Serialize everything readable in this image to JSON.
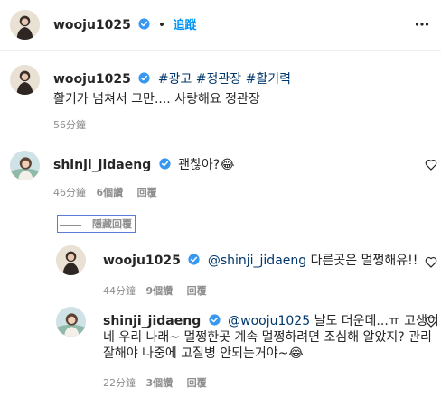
{
  "header": {
    "username": "wooju1025",
    "dot": "•",
    "follow_label": "追蹤",
    "more_icon": "more-horizontal-icon"
  },
  "caption": {
    "username": "wooju1025",
    "hashtags": [
      "#광고",
      "#정관장",
      "#활기력"
    ],
    "text": "활기가 넘쳐서 그만.... 사랑해요 정관장",
    "time": "56分鐘"
  },
  "comments": [
    {
      "username": "shinji_jidaeng",
      "text": "괜찮아?😂",
      "time": "46分鐘",
      "likes": "6個讚",
      "reply_label": "回覆",
      "hide_replies_label": "隱藏回覆"
    }
  ],
  "replies": [
    {
      "username": "wooju1025",
      "mention": "@shinji_jidaeng",
      "text": "다른곳은 멀쩡해유!!",
      "time": "44分鐘",
      "likes": "9個讚",
      "reply_label": "回覆"
    },
    {
      "username": "shinji_jidaeng",
      "mention": "@wooju1025",
      "text_line1": "날도 더운데...ㅠ 고생이",
      "text_line2": "네 우리 나래~ 멀쩡한곳 계속 멀쩡하려면 조심해 알았지? 관리",
      "text_line3": "잘해야 나중에 고질병 안되는거야~😂",
      "time": "22分鐘",
      "likes": "3個讚",
      "reply_label": "回覆"
    }
  ],
  "colors": {
    "text": "#262626",
    "secondary": "#8e8e8e",
    "link": "#00376b",
    "follow": "#0095f6",
    "verified": "#3897f0"
  }
}
